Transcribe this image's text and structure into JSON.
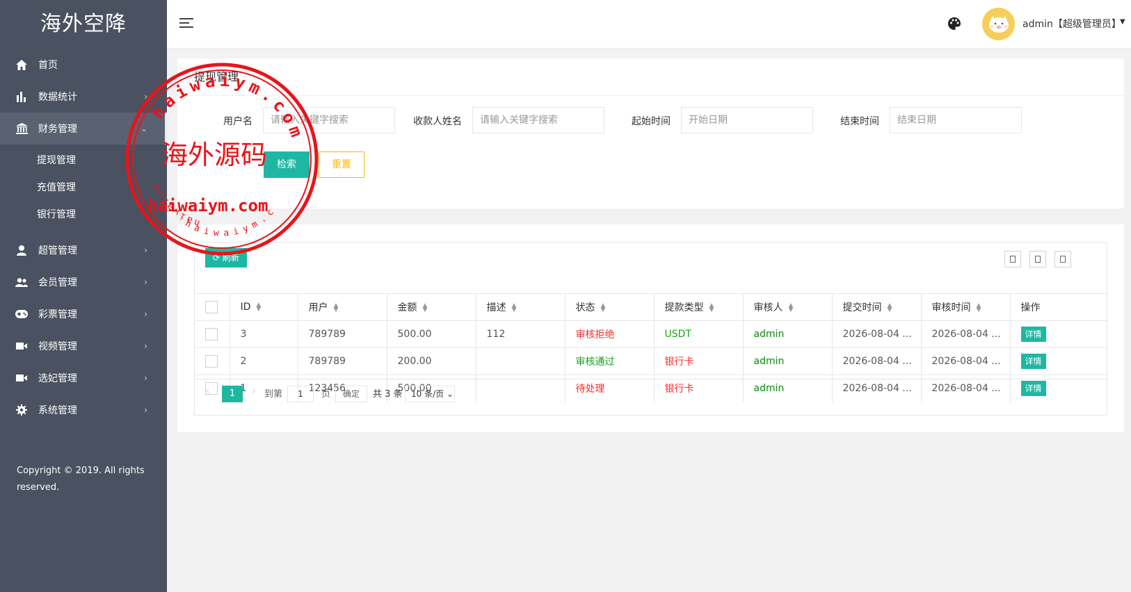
{
  "app": {
    "logo": "海外空降"
  },
  "sidebar": {
    "items": [
      {
        "label": "首页",
        "icon": "home-icon"
      },
      {
        "label": "数据统计",
        "icon": "bar-chart-icon"
      },
      {
        "label": "财务管理",
        "icon": "bank-icon"
      },
      {
        "label": "超管管理",
        "icon": "user-icon"
      },
      {
        "label": "会员管理",
        "icon": "group-icon"
      },
      {
        "label": "彩票管理",
        "icon": "gamepad-icon"
      },
      {
        "label": "视频管理",
        "icon": "video-icon"
      },
      {
        "label": "选妃管理",
        "icon": "video-icon"
      },
      {
        "label": "系统管理",
        "icon": "gear-icon"
      }
    ],
    "sub_items": [
      {
        "label": "提现管理"
      },
      {
        "label": "充值管理"
      },
      {
        "label": "银行管理"
      }
    ],
    "copyright": "Copyright © 2019. All rights reserved."
  },
  "header": {
    "user": "admin【超级管理员】"
  },
  "search": {
    "title": "提现管理",
    "username_label": "用户名",
    "username_placeholder": "请输入关键字搜索",
    "payee_label": "收款人姓名",
    "payee_placeholder": "请输入关键字搜索",
    "start_label": "起始时间",
    "start_placeholder": "开始日期",
    "end_label": "结束时间",
    "end_placeholder": "结束日期",
    "search_btn": "检索",
    "reset_btn": "重置"
  },
  "table": {
    "refresh_btn": "刷新",
    "columns": [
      "ID",
      "用户",
      "金额",
      "描述",
      "状态",
      "提款类型",
      "审核人",
      "提交时间",
      "审核时间",
      "操作"
    ],
    "rows": [
      {
        "id": "3",
        "user": "789789",
        "amount": "500.00",
        "desc": "112",
        "status": "审核拒绝",
        "type": "USDT",
        "auditor": "admin",
        "submit_time": "2026-08-04 ...",
        "audit_time": "2026-08-04 ...",
        "action": "详情"
      },
      {
        "id": "2",
        "user": "789789",
        "amount": "200.00",
        "desc": "",
        "status": "审核通过",
        "type": "银行卡",
        "auditor": "admin",
        "submit_time": "2026-08-04 ...",
        "audit_time": "2026-08-04 ...",
        "action": "详情"
      },
      {
        "id": "1",
        "user": "123456",
        "amount": "500.00",
        "desc": "",
        "status": "待处理",
        "type": "银行卡",
        "auditor": "admin",
        "submit_time": "2026-08-04 ...",
        "audit_time": "2026-08-04 ...",
        "action": "详情"
      }
    ]
  },
  "pager": {
    "current": "1",
    "goto_label": "到第",
    "goto_value": "1",
    "page_label": "页",
    "confirm": "确定",
    "total": "共 3 条",
    "per_page": "10 条/页"
  },
  "watermark": {
    "main": "海外源码",
    "domain": "haiwaiym.com",
    "ring_top": "haiwaiym.com",
    "ring_left": "haiwaiym",
    "ring_bottom": "haiwaiym.com"
  },
  "colors": {
    "sidebar_bg": "#4a5160",
    "accent": "#1eb7a4",
    "warn": "#ffb800",
    "status_red": "#ff2a2a",
    "status_green": "#1aa01a",
    "stamp_red": "#e8141a"
  }
}
